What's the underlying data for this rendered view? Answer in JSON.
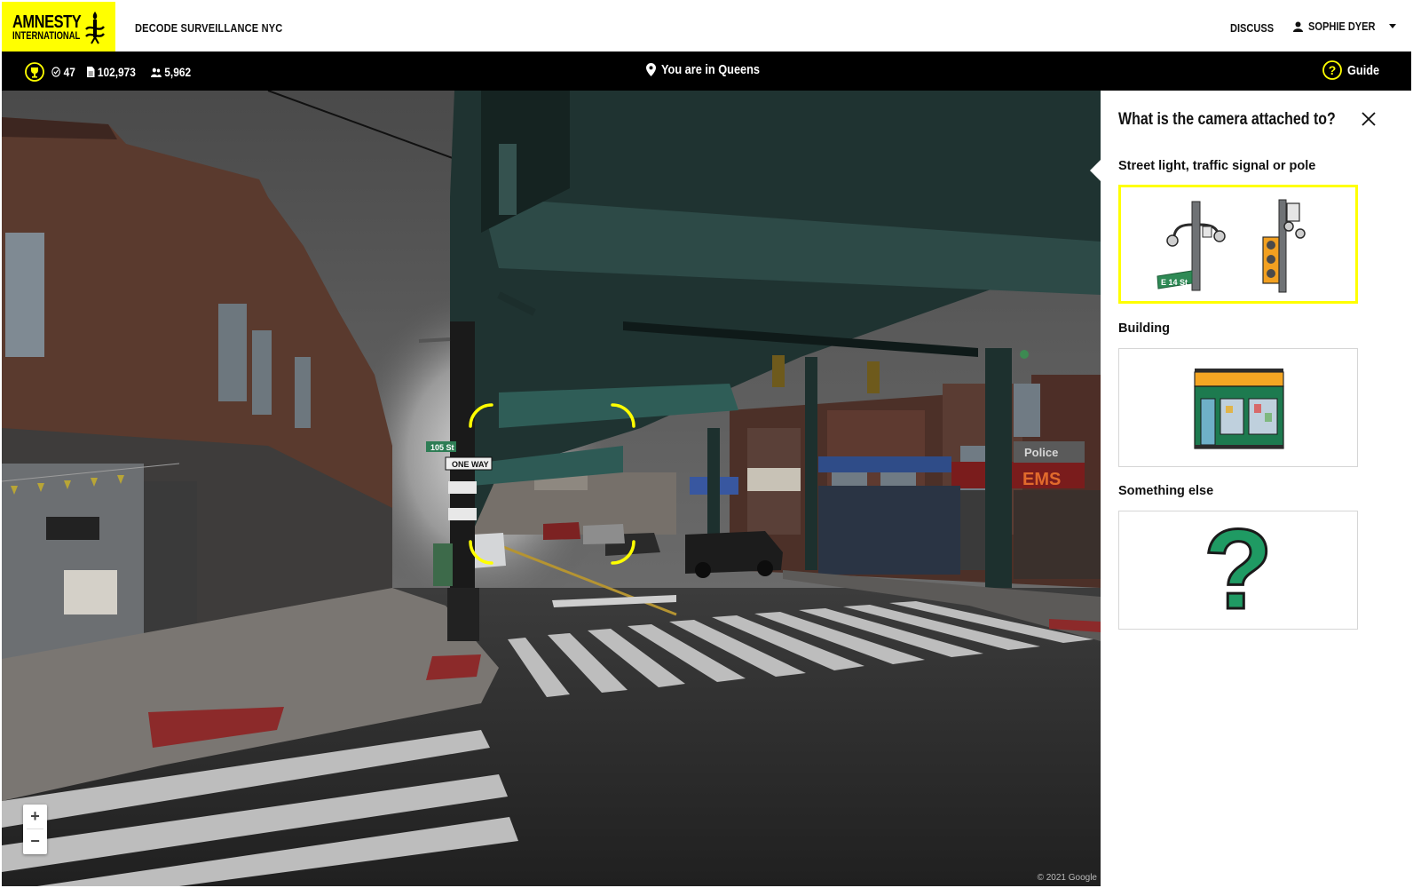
{
  "header": {
    "logo_line1": "AMNESTY",
    "logo_line2": "INTERNATIONAL",
    "title": "DECODE SURVEILLANCE NYC",
    "discuss": "DISCUSS",
    "user_name": "SOPHIE DYER"
  },
  "status": {
    "checked_count": "47",
    "docs_count": "102,973",
    "people_count": "5,962",
    "location": "You are in Queens",
    "guide": "Guide"
  },
  "street_view": {
    "attribution": "© 2021 Google",
    "zoom_in": "+",
    "zoom_out": "−",
    "signs": {
      "street_sign": "105 St",
      "one_way": "ONE WAY",
      "police": "Police",
      "ems": "EMS"
    }
  },
  "panel": {
    "question": "What is the camera attached to?",
    "options": [
      {
        "label": "Street light, traffic signal or pole",
        "selected": true,
        "street_sign_text": "E 14 St"
      },
      {
        "label": "Building",
        "selected": false
      },
      {
        "label": "Something else",
        "selected": false,
        "glyph": "?"
      }
    ]
  },
  "colors": {
    "brand_yellow": "#ffff00",
    "bar_black": "#000000",
    "pole_green": "#1d8a55",
    "awning_orange": "#f5a623"
  },
  "icons": [
    "trophy-icon",
    "check-circle-icon",
    "document-icon",
    "people-icon",
    "map-pin-icon",
    "help-circle-icon",
    "user-icon",
    "caret-down-icon",
    "close-icon",
    "candle-logo-icon"
  ]
}
